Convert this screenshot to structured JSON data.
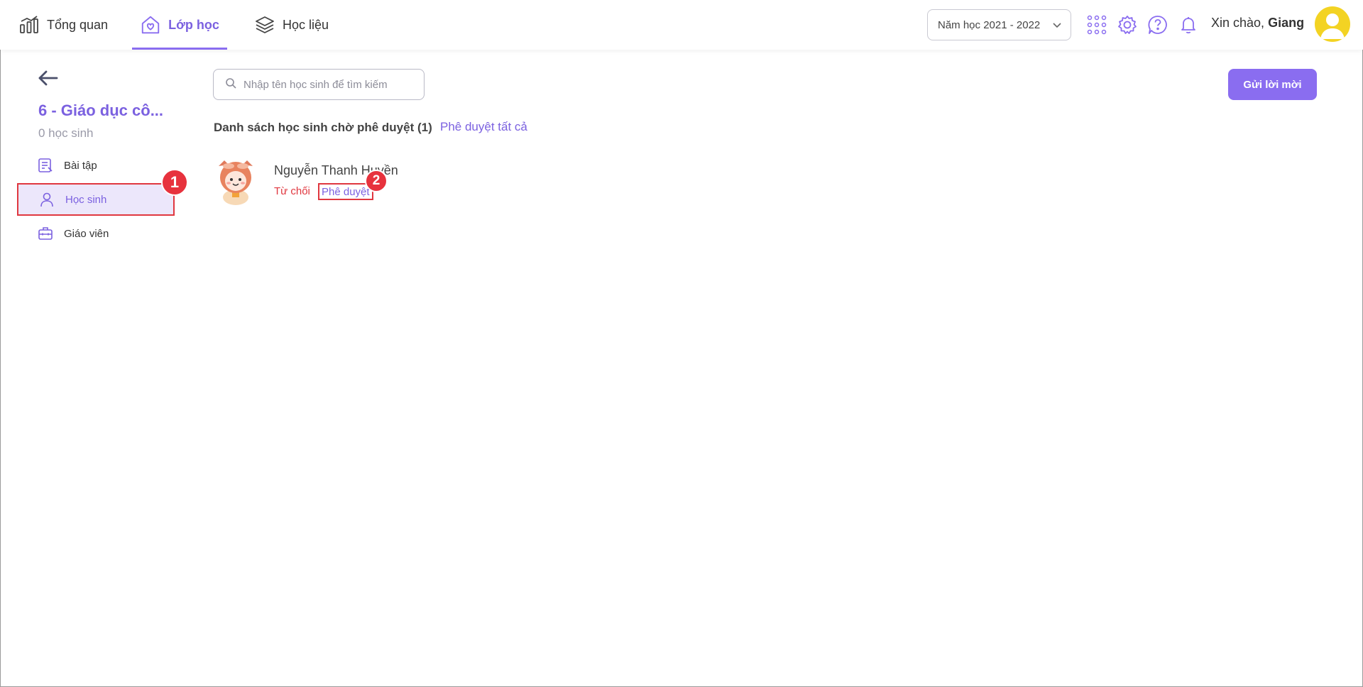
{
  "header": {
    "nav": [
      {
        "label": "Tổng quan",
        "icon": "chart-icon"
      },
      {
        "label": "Lớp học",
        "icon": "house-heart-icon",
        "active": true
      },
      {
        "label": "Học liệu",
        "icon": "layers-icon"
      }
    ],
    "year_select": "Năm học 2021 - 2022",
    "greeting_prefix": "Xin chào,",
    "greeting_name": "Giang",
    "icons": [
      "apps-grid-icon",
      "gear-icon",
      "help-icon",
      "bell-icon"
    ]
  },
  "sidebar": {
    "class_name": "6 - Giáo dục cô...",
    "student_count": "0 học sinh",
    "items": [
      {
        "label": "Bài tập",
        "icon": "assignment-icon"
      },
      {
        "label": "Học sinh",
        "icon": "user-icon",
        "active": true
      },
      {
        "label": "Giáo viên",
        "icon": "briefcase-icon"
      }
    ]
  },
  "main": {
    "search_placeholder": "Nhập tên học sinh để tìm kiếm",
    "invite_button": "Gửi lời mời",
    "list_title": "Danh sách học sinh chờ phê duyệt (1)",
    "approve_all": "Phê duyệt tất cả",
    "students": [
      {
        "name": "Nguyễn Thanh Huyền",
        "reject": "Từ chối",
        "approve": "Phê duyệt"
      }
    ]
  },
  "annotations": {
    "step1": "1",
    "step2": "2"
  },
  "colors": {
    "accent": "#8a6df0",
    "highlight": "#e0373f"
  }
}
